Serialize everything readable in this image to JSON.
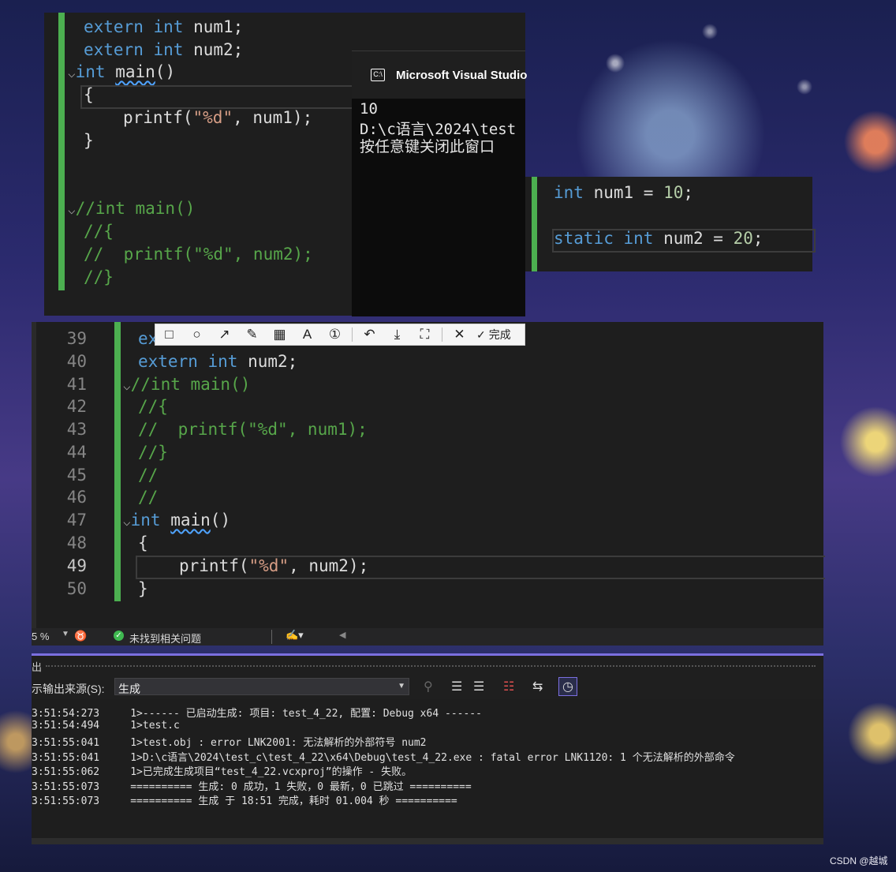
{
  "editor_top": {
    "lines": [
      {
        "a": "extern ",
        "b": "int ",
        "c": "num1;"
      },
      {
        "a": "extern ",
        "b": "int ",
        "c": "num2;"
      }
    ],
    "main_kw": "int ",
    "main_name": "main",
    "main_paren": "()",
    "brace_open": "{",
    "printf_pre": "printf(",
    "printf_str": "\"%d\"",
    "printf_post": ", num1);",
    "brace_close": "}",
    "comment_lines": [
      "//int main()",
      "//{",
      "//  printf(\"%d\", num2);",
      "//}"
    ]
  },
  "console": {
    "title": "Microsoft Visual Studio",
    "lines": [
      "10",
      "D:\\c语言\\2024\\test",
      "按任意键关闭此窗口"
    ]
  },
  "snippet": {
    "line1": {
      "kw": "int ",
      "rest": "num1 = ",
      "num": "10",
      ";": ";"
    },
    "line2": {
      "kw1": "static ",
      "kw2": "int ",
      "rest": "num2 = ",
      "num": "20",
      ";": ";"
    }
  },
  "editor_main": {
    "line_numbers": [
      "39",
      "40",
      "41",
      "42",
      "43",
      "44",
      "45",
      "46",
      "47",
      "48",
      "49",
      "50"
    ],
    "line39_partial": "ex",
    "line40": {
      "kw": "extern ",
      "kw2": "int ",
      "rest": "num2;"
    },
    "comment_lines": [
      "//int main()",
      "//{",
      "//  printf(\"%d\", num1);",
      "//}",
      "//",
      "//"
    ],
    "main_kw": "int ",
    "main_name": "main",
    "main_paren": "()",
    "brace_open": "{",
    "printf_pre": "printf(",
    "printf_str": "\"%d\"",
    "printf_post": ", num2);",
    "brace_close": "}"
  },
  "screenshot_toolbar": {
    "done_label": "完成",
    "icons": [
      "rectangle-icon",
      "ellipse-icon",
      "arrow-icon",
      "pencil-icon",
      "mosaic-icon",
      "text-icon",
      "number-icon",
      "undo-icon",
      "download-icon",
      "ocr-icon",
      "close-icon",
      "check-icon"
    ]
  },
  "status_bar": {
    "zoom": "5 %",
    "issues": "未找到相关问题"
  },
  "output_panel": {
    "source_label": "示输出来源(S):",
    "source_value": "生成",
    "log": [
      "3:51:54:273     1>------ 已启动生成: 项目: test_4_22, 配置: Debug x64 ------",
      "3:51:54:494     1>test.c",
      "3:51:55:041     1>test.obj : error LNK2001: 无法解析的外部符号 num2",
      "3:51:55:041     1>D:\\c语言\\2024\\test_c\\test_4_22\\x64\\Debug\\test_4_22.exe : fatal error LNK1120: 1 个无法解析的外部命令",
      "3:51:55:062     1>已完成生成项目“test_4_22.vcxproj”的操作 - 失败。",
      "3:51:55:073     ========== 生成: 0 成功，1 失败，0 最新，0 已跳过 ==========",
      "3:51:55:073     ========== 生成 于 18:51 完成，耗时 01.004 秒 =========="
    ]
  },
  "watermark": "CSDN @越城"
}
